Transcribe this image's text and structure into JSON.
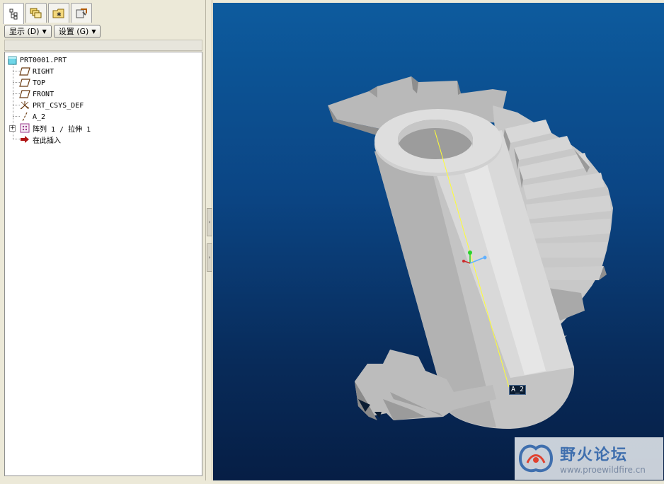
{
  "tabs": [
    {
      "icon": "model-tree-icon",
      "active": true
    },
    {
      "icon": "layers-icon",
      "active": false
    },
    {
      "icon": "folder-browser-icon",
      "active": false
    },
    {
      "icon": "favorites-icon",
      "active": false
    }
  ],
  "toolbar": {
    "show_label": "显示 (D)",
    "settings_label": "设置 (G)"
  },
  "tree": {
    "root": "PRT0001.PRT",
    "items": [
      {
        "label": "RIGHT",
        "icon": "datum-plane-icon"
      },
      {
        "label": "TOP",
        "icon": "datum-plane-icon"
      },
      {
        "label": "FRONT",
        "icon": "datum-plane-icon"
      },
      {
        "label": "PRT_CSYS_DEF",
        "icon": "coordinate-system-icon"
      },
      {
        "label": "A_2",
        "icon": "datum-axis-icon"
      },
      {
        "label": "阵列 1 / 拉伸 1",
        "icon": "pattern-icon"
      },
      {
        "label": "在此插入",
        "icon": "insert-here-arrow-icon"
      }
    ]
  },
  "viewport": {
    "axis_label": "A_2",
    "background_top": "#0d5b9e",
    "background_bottom": "#061e45"
  },
  "watermark": {
    "title": "野火论坛",
    "url": "www.proewildfire.cn"
  }
}
